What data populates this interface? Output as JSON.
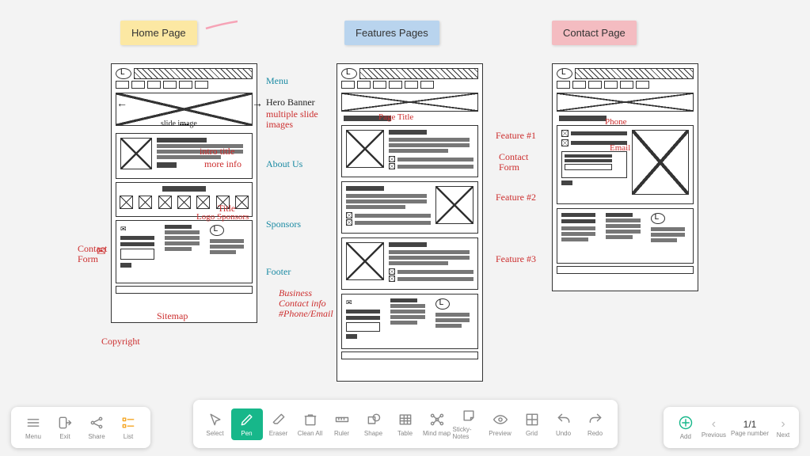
{
  "stickies": {
    "home": "Home Page",
    "features": "Features Pages",
    "contact": "Contact Page"
  },
  "annot": {
    "menu": "Menu",
    "hero": "Hero Banner",
    "multi": "multiple slide images",
    "slide": "slide image",
    "intro": "intro title",
    "more": "more info",
    "about": "About Us",
    "title": "Title",
    "logosp": "Logo Sponsors",
    "sponsors": "Sponsors",
    "contactForm": "Contact Form",
    "contactForm2": "Contact Form",
    "footer": "Footer",
    "sitemap": "Sitemap",
    "business": "Business Contact info #Phone/Email",
    "copyright": "Copyright",
    "pageTitle": "Page Title",
    "f1": "Feature #1",
    "f2": "Feature #2",
    "f3": "Feature #3",
    "phone": "Phone",
    "email": "Email"
  },
  "toolLeft": [
    "Menu",
    "Exit",
    "Share",
    "List"
  ],
  "toolCenter": [
    "Select",
    "Pen",
    "Eraser",
    "Clean All",
    "Ruler",
    "Shape",
    "Table",
    "Mind map",
    "Sticky-Notes",
    "Preview",
    "Grid",
    "Undo",
    "Redo"
  ],
  "toolRight": {
    "add": "Add",
    "prev": "Previous",
    "page": "1/1",
    "pageLbl": "Page number",
    "next": "Next"
  }
}
